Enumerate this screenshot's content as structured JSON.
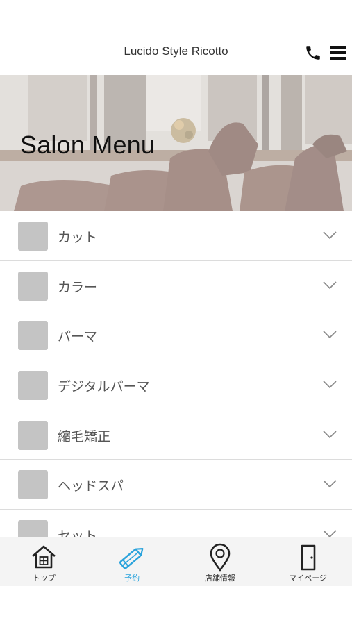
{
  "header": {
    "title": "Lucido Style Ricotto",
    "phone_icon": "phone-icon",
    "menu_icon": "hamburger-menu-icon"
  },
  "hero": {
    "title": "Salon Menu"
  },
  "menu": {
    "items": [
      {
        "label": "カット"
      },
      {
        "label": "カラー"
      },
      {
        "label": "パーマ"
      },
      {
        "label": "デジタルパーマ"
      },
      {
        "label": "縮毛矯正"
      },
      {
        "label": "ヘッドスパ"
      },
      {
        "label": "セット"
      }
    ]
  },
  "bottom_nav": {
    "items": [
      {
        "label": "トップ",
        "icon": "home-icon"
      },
      {
        "label": "予約",
        "icon": "pencil-icon",
        "active": true
      },
      {
        "label": "店舗情報",
        "icon": "map-pin-icon"
      },
      {
        "label": "マイページ",
        "icon": "door-icon"
      }
    ],
    "active_color": "#2aa3dc"
  }
}
